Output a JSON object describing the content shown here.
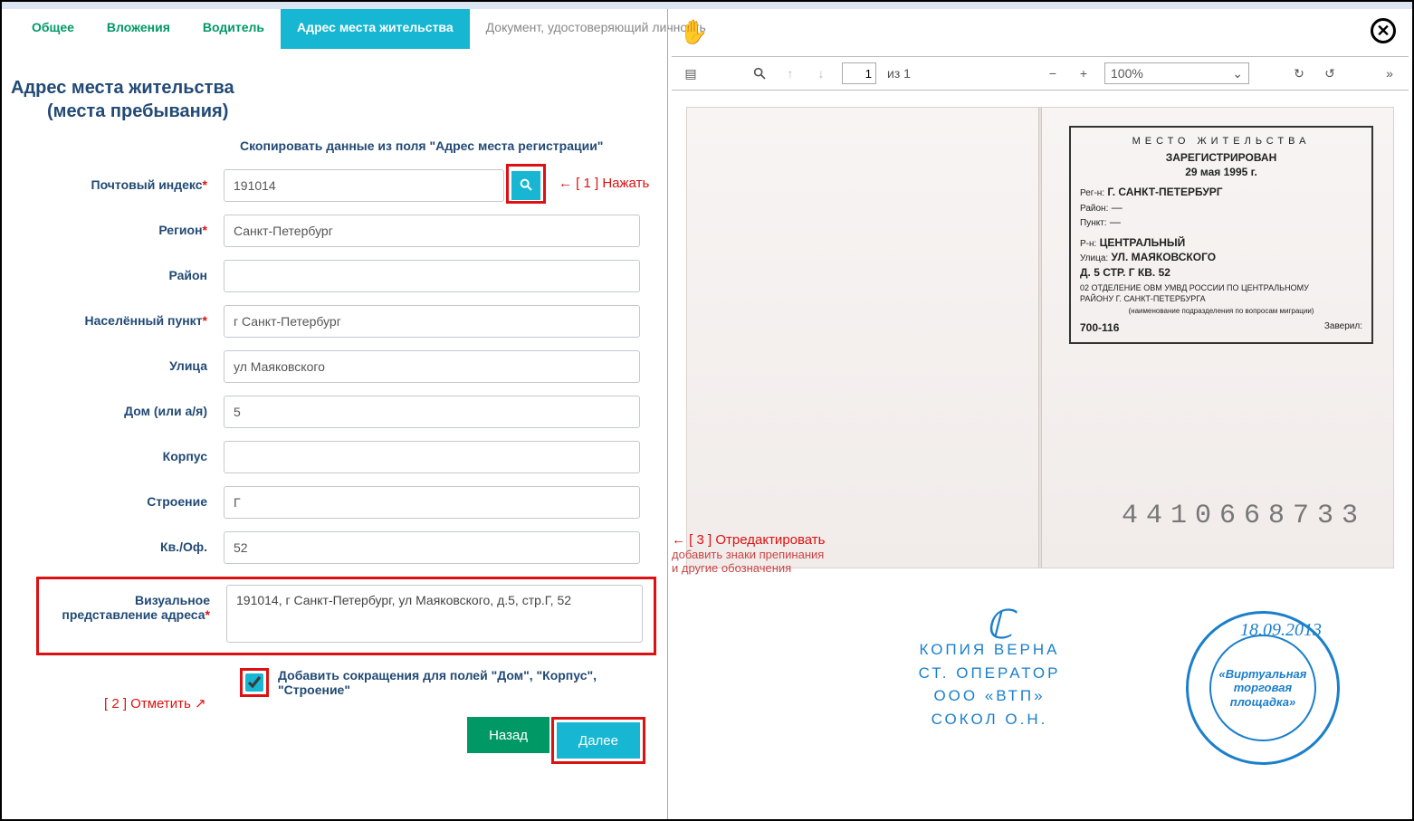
{
  "tabs": {
    "general": "Общее",
    "attachments": "Вложения",
    "driver": "Водитель",
    "address": "Адрес места жительства",
    "identity": "Документ, удостоверяющий личность"
  },
  "heading": {
    "line1": "Адрес места жительства",
    "line2": "(места пребывания)"
  },
  "copy_link": "Скопировать данные из поля \"Адрес места регистрации\"",
  "labels": {
    "postcode": "Почтовый индекс",
    "region": "Регион",
    "district": "Район",
    "locality": "Населённый пункт",
    "street": "Улица",
    "house": "Дом (или а/я)",
    "korpus": "Корпус",
    "building": "Строение",
    "apt": "Кв./Оф.",
    "visual": "Визуальное представление адреса"
  },
  "values": {
    "postcode": "191014",
    "region": "Санкт-Петербург",
    "district": "",
    "locality": "г Санкт-Петербург",
    "street": "ул Маяковского",
    "house": "5",
    "korpus": "",
    "building": "Г",
    "apt": "52",
    "visual": "191014, г Санкт-Петербург, ул Маяковского, д.5, стр.Г, 52"
  },
  "checkbox": {
    "label": "Добавить сокращения для полей \"Дом\", \"Корпус\", \"Строение\"",
    "checked": true
  },
  "buttons": {
    "back": "Назад",
    "next": "Далее"
  },
  "annotations": {
    "a1": "← [ 1 ] Нажать",
    "a2": "[ 2 ] Отметить ↗",
    "a3_title": "← [ 3 ] Отредактировать",
    "a3_l1": "добавить знаки препинания",
    "a3_l2": "и другие обозначения"
  },
  "viewer": {
    "page_current": "1",
    "page_total": "из 1",
    "zoom": "100%"
  },
  "passport": {
    "heading": "МЕСТО ЖИТЕЛЬСТВА",
    "registered": "ЗАРЕГИСТРИРОВАН",
    "date": "29 мая 1995 г.",
    "region_k": "Рег-н:",
    "region_v": "Г. САНКТ-ПЕТЕРБУРГ",
    "rayon_k": "Район:",
    "rayon_v": "—",
    "punkt_k": "Пункт:",
    "punkt_v": "—",
    "rn_k": "Р-н:",
    "rn_v": "ЦЕНТРАЛЬНЫЙ",
    "street_k": "Улица:",
    "street_v": "УЛ. МАЯКОВСКОГО",
    "addr": "Д. 5  СТР. Г  КВ. 52",
    "dept1": "02 ОТДЕЛЕНИЕ ОВМ УМВД РОССИИ ПО ЦЕНТРАЛЬНОМУ",
    "dept2": "РАЙОНУ Г. САНКТ-ПЕТЕРБУРГА",
    "subnote": "(наименование подразделения по вопросам миграции)",
    "code": "700-116",
    "verified": "Заверил:",
    "docnum": "4410668733"
  },
  "seal": {
    "line1": "КОПИЯ  ВЕРНА",
    "line2": "СТ. ОПЕРАТОР",
    "line3": "ООО  «ВТП»",
    "line4": "СОКОЛ О.Н.",
    "date": "18.09.2013",
    "round1": "«Виртуальная",
    "round2": "торговая",
    "round3": "площадка»"
  }
}
